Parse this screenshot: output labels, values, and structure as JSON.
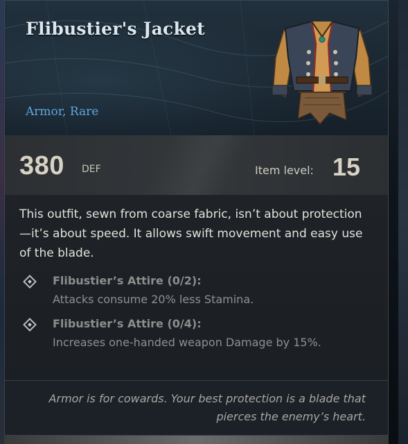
{
  "item": {
    "name": "Flibustier's Jacket",
    "type_rarity": "Armor, Rare",
    "image_icon": "jacket-icon"
  },
  "stats": {
    "defense_value": "380",
    "defense_unit": "DEF",
    "item_level_label": "Item level:",
    "item_level_value": "15"
  },
  "description": "This outfit, sewn from coarse fabric, isn’t about protection—it’s about speed. It allows swift movement and easy use of the blade.",
  "set_bonuses": [
    {
      "name": "Flibustier’s Attire (0/2):",
      "effect": "Attacks consume 20% less Stamina."
    },
    {
      "name": "Flibustier’s Attire (0/4):",
      "effect": "Increases one-handed weapon Damage by 15%."
    }
  ],
  "flavor_text": "Armor is for cowards. Your best protection is a blade that pierces the enemy’s heart.",
  "colors": {
    "title": "#dbe7f0",
    "rarity": "#5ea6dd",
    "stat_text": "#d7d2c4",
    "set_text": "#8f8f8f"
  }
}
